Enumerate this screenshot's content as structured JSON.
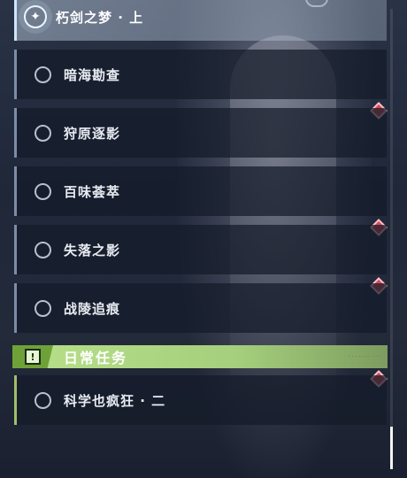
{
  "quests": {
    "active": {
      "label": "朽剑之梦 · 上",
      "icon": "compass-icon"
    },
    "items": [
      {
        "label": "暗海勘查"
      },
      {
        "label": "狩原逐影"
      },
      {
        "label": "百味荟萃"
      },
      {
        "label": "失落之影"
      },
      {
        "label": "战陵追痕"
      }
    ]
  },
  "daily_section": {
    "title": "日常任务",
    "icon": "exclamation-icon",
    "badge_glyph": "!",
    "items": [
      {
        "label": "科学也疯狂 · 二"
      }
    ]
  },
  "scroll_position": 0.92,
  "colors": {
    "accent_daily": "#b8e08a",
    "marker_red": "#d54c5c",
    "active_row": "#cfe6ff"
  }
}
